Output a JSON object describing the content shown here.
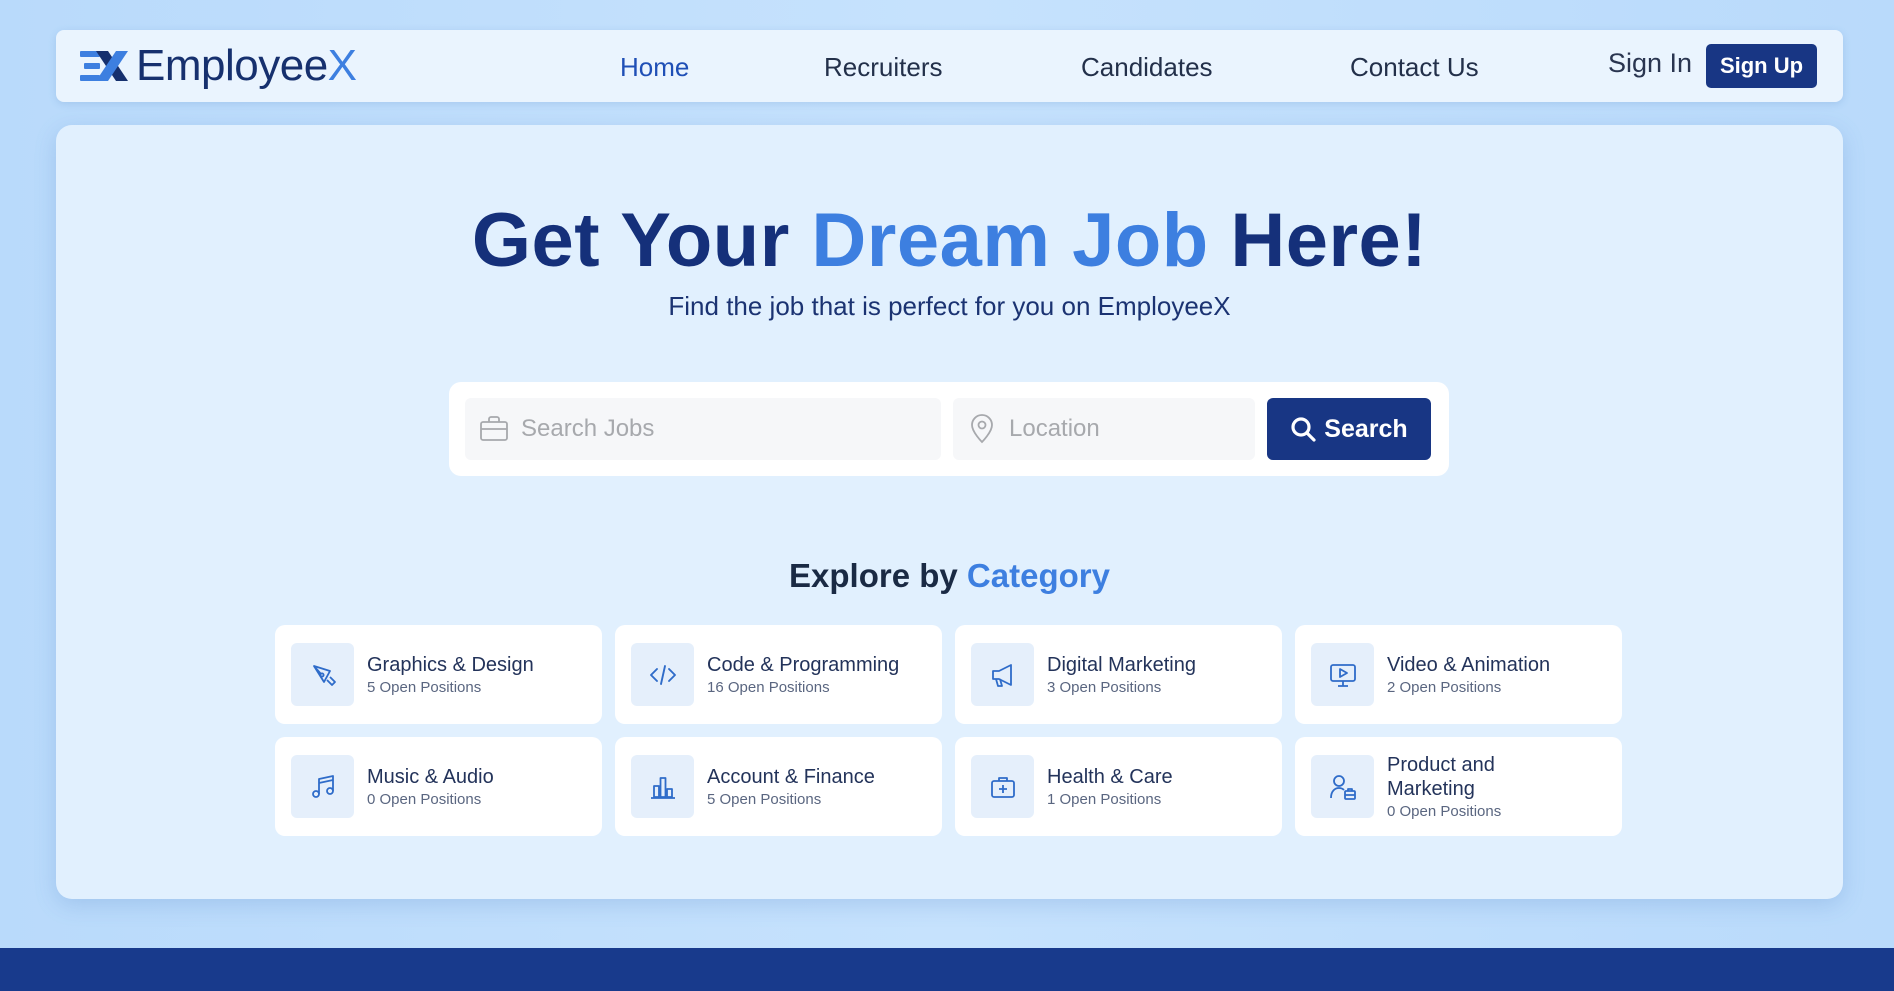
{
  "brand": {
    "name_main": "Employee",
    "name_accent": "X"
  },
  "nav": {
    "links": [
      "Home",
      "Recruiters",
      "Candidates",
      "Contact Us"
    ],
    "active": "Home",
    "sign_in": "Sign In",
    "sign_up": "Sign Up"
  },
  "hero": {
    "title_part1": "Get Your ",
    "title_accent": "Dream Job",
    "title_part2": " Here!",
    "subtitle": "Find the job that is perfect for you on EmployeeX"
  },
  "search": {
    "jobs_placeholder": "Search Jobs",
    "location_placeholder": "Location",
    "button": "Search"
  },
  "explore": {
    "part1": "Explore by ",
    "accent": "Category"
  },
  "categories": [
    {
      "name": "Graphics & Design",
      "count": "5 Open Positions",
      "icon": "pen-tool-icon"
    },
    {
      "name": "Code & Programming",
      "count": "16 Open Positions",
      "icon": "code-icon"
    },
    {
      "name": "Digital Marketing",
      "count": "3 Open Positions",
      "icon": "megaphone-icon"
    },
    {
      "name": "Video & Animation",
      "count": "2 Open Positions",
      "icon": "video-monitor-icon"
    },
    {
      "name": "Music & Audio",
      "count": "0 Open Positions",
      "icon": "music-note-icon"
    },
    {
      "name": "Account & Finance",
      "count": "5 Open Positions",
      "icon": "bar-chart-icon"
    },
    {
      "name": "Health & Care",
      "count": "1 Open Positions",
      "icon": "medical-kit-icon"
    },
    {
      "name": "Product and Marketing",
      "count": "0 Open Positions",
      "icon": "user-briefcase-icon"
    }
  ],
  "colors": {
    "primary": "#183684",
    "accent": "#3d7fe0",
    "heading": "#15307a"
  }
}
